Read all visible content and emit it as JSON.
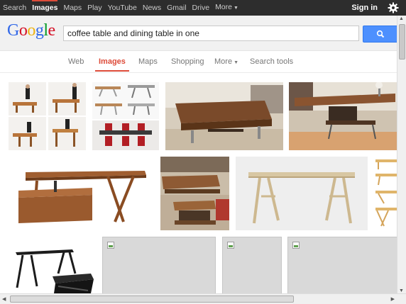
{
  "topbar": {
    "links": [
      {
        "label": "Search",
        "active": false
      },
      {
        "label": "Images",
        "active": true
      },
      {
        "label": "Maps",
        "active": false
      },
      {
        "label": "Play",
        "active": false
      },
      {
        "label": "YouTube",
        "active": false
      },
      {
        "label": "News",
        "active": false
      },
      {
        "label": "Gmail",
        "active": false
      },
      {
        "label": "Drive",
        "active": false
      }
    ],
    "more_label": "More",
    "signin_label": "Sign in",
    "settings_icon": "gear-icon"
  },
  "header": {
    "logo_letters": [
      "G",
      "o",
      "o",
      "g",
      "l",
      "e"
    ],
    "query": "coffee table and dining table in one",
    "search_icon": "magnifier-icon",
    "accent": "#4d90fe"
  },
  "tabs": {
    "web": "Web",
    "images": "Images",
    "maps": "Maps",
    "shopping": "Shopping",
    "more": "More",
    "search_tools": "Search tools",
    "active": "Images",
    "active_color": "#dd4b39"
  },
  "results": [
    {
      "label": "transforming table steps collage"
    },
    {
      "label": "adjustable table configurations"
    },
    {
      "label": "walnut lift-top coffee table on rug"
    },
    {
      "label": "walnut table raised to dining height"
    },
    {
      "label": "wooden convertible table"
    },
    {
      "label": "lift-top table in living room"
    },
    {
      "label": "light wood trestle table"
    },
    {
      "label": "folding table stages"
    },
    {
      "label": "black nesting tables"
    },
    {
      "label": "image not loaded"
    },
    {
      "label": "image not loaded"
    },
    {
      "label": "image not loaded"
    }
  ]
}
